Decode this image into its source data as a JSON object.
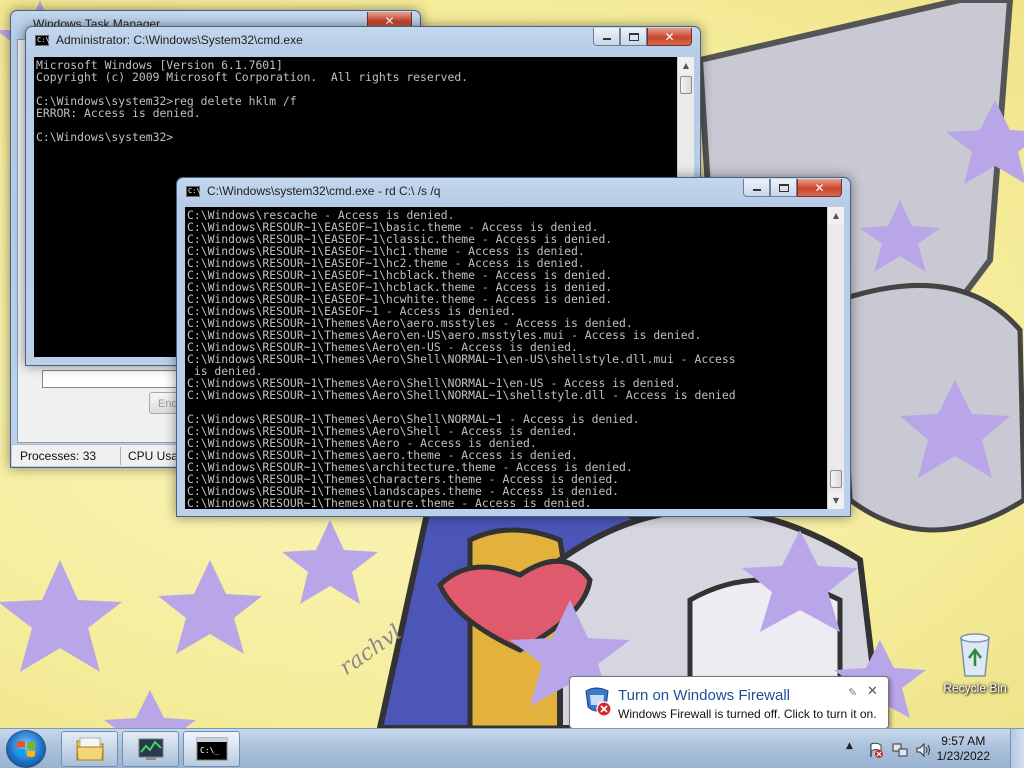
{
  "desktop": {
    "recycle_bin_label": "Recycle Bin",
    "wallpaper_signature": "rachvl"
  },
  "task_manager": {
    "title": "Windows Task Manager",
    "status": {
      "processes": "Processes: 33",
      "cpu": "CPU Usag"
    },
    "end_button": "End"
  },
  "cmd_admin": {
    "title": "Administrator: C:\\Windows\\System32\\cmd.exe",
    "lines": [
      "Microsoft Windows [Version 6.1.7601]",
      "Copyright (c) 2009 Microsoft Corporation.  All rights reserved.",
      "",
      "C:\\Windows\\system32>reg delete hklm /f",
      "ERROR: Access is denied.",
      "",
      "C:\\Windows\\system32>"
    ]
  },
  "cmd_rd": {
    "title": "C:\\Windows\\system32\\cmd.exe - rd  C:\\ /s /q",
    "lines": [
      "C:\\Windows\\rescache - Access is denied.",
      "C:\\Windows\\RESOUR~1\\EASEOF~1\\basic.theme - Access is denied.",
      "C:\\Windows\\RESOUR~1\\EASEOF~1\\classic.theme - Access is denied.",
      "C:\\Windows\\RESOUR~1\\EASEOF~1\\hc1.theme - Access is denied.",
      "C:\\Windows\\RESOUR~1\\EASEOF~1\\hc2.theme - Access is denied.",
      "C:\\Windows\\RESOUR~1\\EASEOF~1\\hcblack.theme - Access is denied.",
      "C:\\Windows\\RESOUR~1\\EASEOF~1\\hcblack.theme - Access is denied.",
      "C:\\Windows\\RESOUR~1\\EASEOF~1\\hcwhite.theme - Access is denied.",
      "C:\\Windows\\RESOUR~1\\EASEOF~1 - Access is denied.",
      "C:\\Windows\\RESOUR~1\\Themes\\Aero\\aero.msstyles - Access is denied.",
      "C:\\Windows\\RESOUR~1\\Themes\\Aero\\en-US\\aero.msstyles.mui - Access is denied.",
      "C:\\Windows\\RESOUR~1\\Themes\\Aero\\en-US - Access is denied.",
      "C:\\Windows\\RESOUR~1\\Themes\\Aero\\Shell\\NORMAL~1\\en-US\\shellstyle.dll.mui - Access",
      " is denied.",
      "C:\\Windows\\RESOUR~1\\Themes\\Aero\\Shell\\NORMAL~1\\en-US - Access is denied.",
      "C:\\Windows\\RESOUR~1\\Themes\\Aero\\Shell\\NORMAL~1\\shellstyle.dll - Access is denied",
      "",
      "C:\\Windows\\RESOUR~1\\Themes\\Aero\\Shell\\NORMAL~1 - Access is denied.",
      "C:\\Windows\\RESOUR~1\\Themes\\Aero\\Shell - Access is denied.",
      "C:\\Windows\\RESOUR~1\\Themes\\Aero - Access is denied.",
      "C:\\Windows\\RESOUR~1\\Themes\\aero.theme - Access is denied.",
      "C:\\Windows\\RESOUR~1\\Themes\\architecture.theme - Access is denied.",
      "C:\\Windows\\RESOUR~1\\Themes\\characters.theme - Access is denied.",
      "C:\\Windows\\RESOUR~1\\Themes\\landscapes.theme - Access is denied.",
      "C:\\Windows\\RESOUR~1\\Themes\\nature.theme - Access is denied."
    ]
  },
  "balloon": {
    "title": "Turn on Windows Firewall",
    "body": "Windows Firewall is turned off. Click to turn it on."
  },
  "taskbar": {
    "time": "9:57 AM",
    "date": "1/23/2022",
    "pinned": [
      {
        "name": "explorer",
        "icon": "folder-icon"
      },
      {
        "name": "task-manager",
        "icon": "task-manager-icon"
      },
      {
        "name": "cmd",
        "icon": "cmd-icon"
      }
    ]
  },
  "colors": {
    "wallpaper": "#f5ec9a",
    "stars": "#b9a6e8",
    "console_bg": "#000000",
    "console_text": "#c0c0c0",
    "balloon_title": "#1e4f97"
  }
}
